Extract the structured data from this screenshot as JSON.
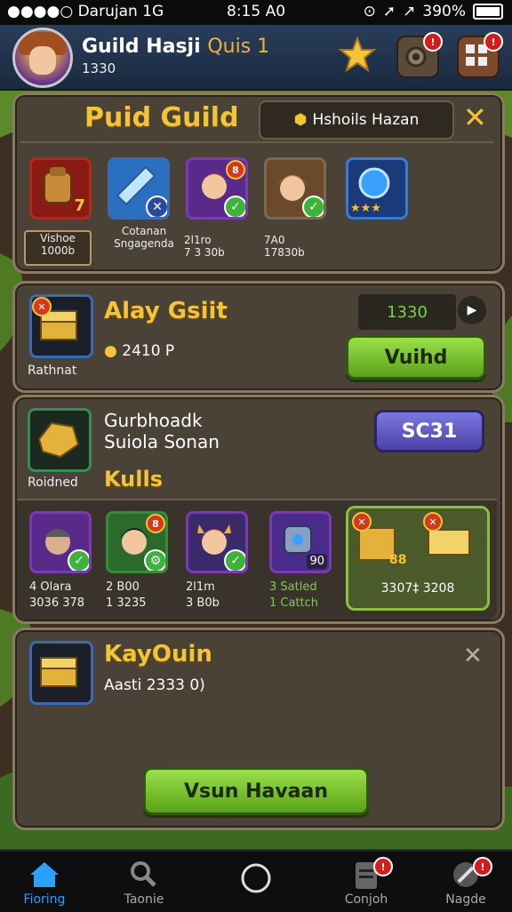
{
  "status_bar": {
    "carrier": "●●●●○ Darujan  1G",
    "time": "8:15 A0",
    "battery_text": "390%"
  },
  "header": {
    "title": "Guild Hasji",
    "title_suffix": "Quis 1",
    "subtitle": "1330"
  },
  "guild_panel": {
    "title": "Puid Guild",
    "search_label": "Hshoils Hazan",
    "members": [
      {
        "label": "Vishoe\n1000b",
        "icon": "backpack-icon"
      },
      {
        "label": "Cotanan\nSngagenda",
        "icon": "blue-shard-icon"
      },
      {
        "label": "2l1ro\n7 3 30b",
        "icon": "red-hair-hero-icon"
      },
      {
        "label": "7A0\n17830b",
        "icon": "blonde-hero-icon"
      },
      {
        "label": "",
        "icon": "blue-orb-icon"
      }
    ],
    "slot_badge_1": "7"
  },
  "alay_panel": {
    "title": "Alay Gsiit",
    "sub": "Rathnat",
    "amount": "2410 P",
    "counter_value": "1330",
    "action_label": "Vuihd"
  },
  "gurbhoadk_panel": {
    "title_line1": "Gurbhoadk",
    "title_line2": "Suiola Sonan",
    "sub": "Roidned",
    "button_label": "SC31",
    "section_title": "Kulls",
    "heroes": [
      {
        "label_1": "4 Olara",
        "label_2": "3036 378"
      },
      {
        "label_1": "2 B00",
        "label_2": "1 3235"
      },
      {
        "label_1": "2l1m",
        "label_2": "3 B0b"
      },
      {
        "label_1": "3 Satled",
        "label_2": "1 Cattch"
      }
    ],
    "reward_value": "3307‡ 3208",
    "reward_count": "88",
    "robot_count": "90"
  },
  "kay_panel": {
    "title": "KayOuin",
    "sub": "Aasti 2333 0)",
    "cta_label": "Vsun Havaan"
  },
  "tabs": [
    {
      "label": "Fioring",
      "icon": "home-icon"
    },
    {
      "label": "Taonie",
      "icon": "search-icon"
    },
    {
      "label": "",
      "icon": "circle-button-icon"
    },
    {
      "label": "Conjoh",
      "icon": "clipboard-icon"
    },
    {
      "label": "Nagde",
      "icon": "compass-icon"
    }
  ],
  "colors": {
    "gold": "#f4c437",
    "accent_green": "#5aa21a",
    "accent_purple": "#4a42a8",
    "tab_active": "#2aa0ff"
  }
}
